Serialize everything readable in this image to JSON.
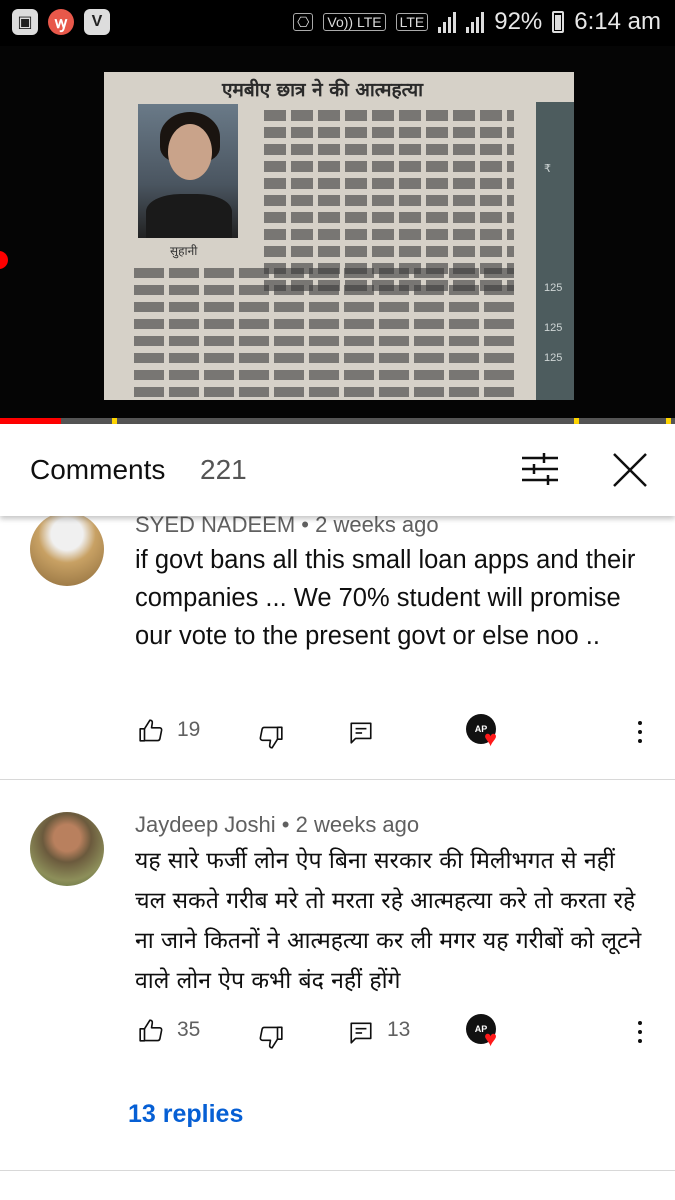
{
  "status_bar": {
    "time": "6:14 am",
    "battery": "92%",
    "network_label": "LTE",
    "volte_label": "Vo)) LTE",
    "app_icons": [
      "gallery-icon",
      "app-red-icon",
      "vidmate-icon"
    ],
    "v_label": "V"
  },
  "video": {
    "headline": "एमबीए छात्र ने की आत्महत्या",
    "caption": "सुहानी",
    "progress_fraction": 0.09
  },
  "comments_header": {
    "title": "Comments",
    "count": "221"
  },
  "comments": [
    {
      "author": "SYED NADEEM",
      "time": "2 weeks ago",
      "text": "if govt bans all this small loan apps and their companies ... We 70% student will promise our vote to the present govt or else noo ..",
      "likes": "19",
      "replies": ""
    },
    {
      "author": "Jaydeep Joshi",
      "time": "2 weeks ago",
      "text": "यह सारे फर्जी लोन ऐप बिना सरकार की मिलीभगत से नहीं चल सकते गरीब मरे तो मरता रहे आत्महत्या करे तो करता रहे ना जाने कितनों ने आत्महत्या कर ली मगर यह गरीबों को लूटने वाले लोन ऐप कभी बंद नहीं होंगे",
      "likes": "35",
      "replies": "13",
      "replies_link": "13 replies"
    }
  ],
  "colors": {
    "link": "#065fd4",
    "progress": "#ff0000",
    "heart": "#ff1a1a"
  }
}
